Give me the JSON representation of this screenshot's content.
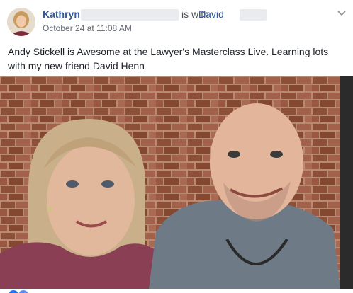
{
  "post": {
    "author": "Kathryn",
    "with_text": "is with",
    "tagged": "David",
    "timestamp": "October 24 at 11:08 AM",
    "text": "Andy Stickell is Awesome at the Lawyer's Masterclass Live. Learning lots with my new friend David Henn"
  },
  "icons": {
    "menu": "chevron-down-icon"
  },
  "colors": {
    "link": "#365899",
    "meta": "#616770",
    "text": "#1d2129",
    "brick": "#8c5a42"
  }
}
